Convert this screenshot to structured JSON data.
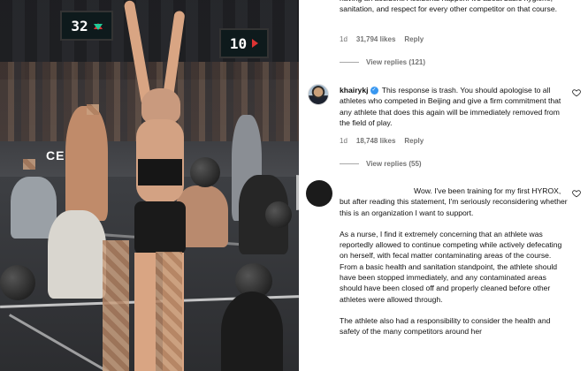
{
  "photo": {
    "scoreboard_left": "32",
    "scoreboard_right": "10",
    "banner_text": "CE"
  },
  "comments": [
    {
      "id": "c1",
      "text": "having an accident. Accidents happen. It's about basic hygiene, sanitation, and respect for every other competitor on that course.",
      "time": "1d",
      "likes": "31,794 likes",
      "reply": "Reply",
      "view_replies": "View replies (121)"
    },
    {
      "id": "c2",
      "username": "khairykj",
      "text": "This response is trash. You should apologise to all athletes who competed in Beijing and give a firm commitment that any athlete that does this again will be immediately removed from the field of play.",
      "time": "1d",
      "likes": "18,748 likes",
      "reply": "Reply",
      "view_replies": "View replies (55)"
    },
    {
      "id": "c3",
      "paragraphs": [
        "Wow. I've been training for my first HYROX, but after reading this statement, I'm seriously reconsidering whether this is an organization I want to support.",
        "As a nurse, I find it extremely concerning that an athlete was reportedly allowed to continue competing while actively defecating on herself, with fecal matter contaminating areas of the course. From a basic health and sanitation standpoint, the athlete should have been stopped immediately, and any contaminated areas should have been closed off and properly cleaned before other athletes were allowed through.",
        "The athlete also had a responsibility to consider the health and safety of the many competitors around her"
      ]
    }
  ],
  "colors": {
    "meta": "#737373",
    "heart": "#262626",
    "verified": "#3897f0"
  }
}
